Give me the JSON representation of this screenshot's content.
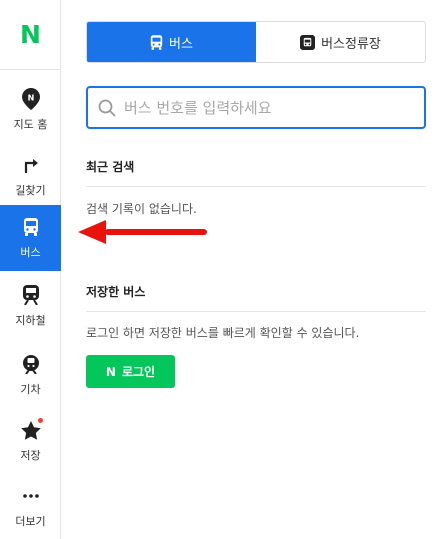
{
  "brand": {
    "logo_letter": "N",
    "logo_color": "#03c75a"
  },
  "sidebar": {
    "items": [
      {
        "label": "지도 홈",
        "icon": "map-pin-icon"
      },
      {
        "label": "길찾기",
        "icon": "directions-icon"
      },
      {
        "label": "버스",
        "icon": "bus-icon",
        "active": true
      },
      {
        "label": "지하철",
        "icon": "subway-icon"
      },
      {
        "label": "기차",
        "icon": "train-icon"
      },
      {
        "label": "저장",
        "icon": "star-icon",
        "has_dot": true
      },
      {
        "label": "더보기",
        "icon": "more-icon"
      }
    ]
  },
  "tabs": [
    {
      "label": "버스",
      "icon": "bus-icon",
      "active": true
    },
    {
      "label": "버스정류장",
      "icon": "bus-stop-icon",
      "active": false
    }
  ],
  "search": {
    "placeholder": "버스 번호를 입력하세요",
    "value": ""
  },
  "recent": {
    "title": "최근 검색",
    "empty_text": "검색 기록이 없습니다."
  },
  "saved": {
    "title": "저장한 버스",
    "message": "로그인 하면 저장한 버스를 빠르게 확인할 수 있습니다.",
    "login_label": "로그인",
    "login_logo": "N"
  },
  "colors": {
    "accent": "#1a73e8",
    "brand_green": "#03c75a",
    "annotation_arrow": "#e8130c"
  }
}
